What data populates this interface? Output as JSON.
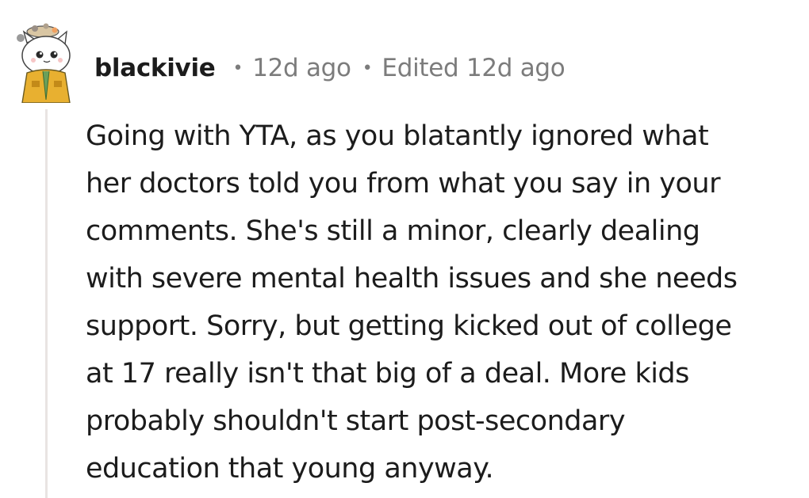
{
  "comment": {
    "author": "blackivie",
    "separator": "•",
    "posted": "12d ago",
    "edited": "Edited 12d ago",
    "avatar_icon": "cat-avatar-icon",
    "body": "Going with YTA, as you blatantly ignored what\nher doctors told you from what you say in your\ncomments. She's still a minor, clearly dealing\nwith severe mental health issues and she needs\nsupport. Sorry, but getting kicked out of college\nat 17 really isn't that big of a deal. More kids\nprobably shouldn't start post-secondary\neducation that young anyway."
  },
  "colors": {
    "text": "#1c1c1c",
    "meta": "#7c7c7c",
    "thread_line": "#e9e4e2",
    "avatar_jacket": "#e8b030",
    "avatar_face": "#ffffff"
  }
}
